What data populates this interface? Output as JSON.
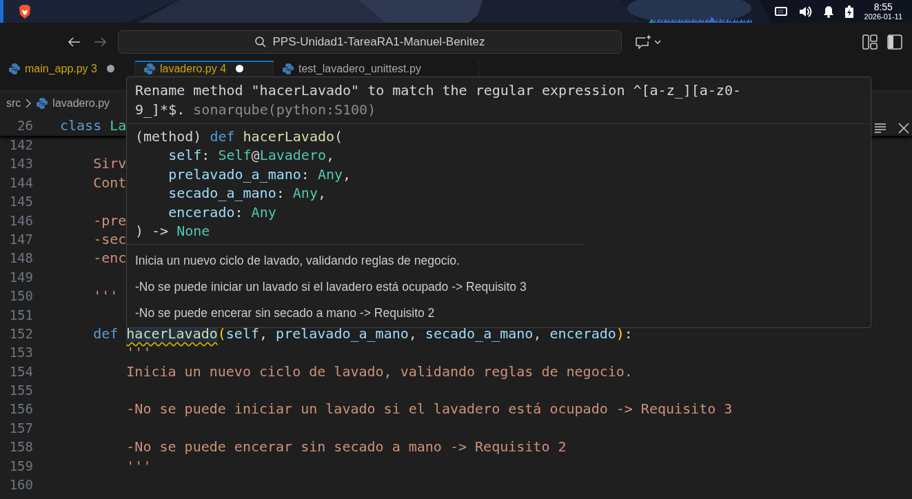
{
  "desktop_panel": {
    "time": "8:55",
    "date": "2026-01-11"
  },
  "title_bar": {
    "search": "PPS-Unidad1-TareaRA1-Manuel-Benitez",
    "forward_disabled": true
  },
  "tabs": [
    {
      "label": "main_app.py",
      "problems": "3",
      "modified": true,
      "selected": false
    },
    {
      "label": "lavadero.py",
      "problems": "4",
      "modified": true,
      "selected": true
    },
    {
      "label": "test_lavadero_unittest.py",
      "modified": false,
      "selected": false
    }
  ],
  "breadcrumb": [
    "src",
    "lavadero.py"
  ],
  "sticky_line": {
    "number": "26",
    "tokens": [
      {
        "text": "class ",
        "kind": "keyword"
      },
      {
        "text": "La",
        "kind": "type"
      }
    ]
  },
  "editor_lines": [
    {
      "number": "142"
    },
    {
      "number": "143",
      "tokens": [
        {
          "text": "    Sirv",
          "kind": "string"
        }
      ]
    },
    {
      "number": "144",
      "tokens": [
        {
          "text": "    Cont",
          "kind": "string"
        }
      ]
    },
    {
      "number": "145"
    },
    {
      "number": "146",
      "tokens": [
        {
          "text": "    -pre",
          "kind": "string"
        }
      ]
    },
    {
      "number": "147",
      "tokens": [
        {
          "text": "    -sec",
          "kind": "string"
        }
      ]
    },
    {
      "number": "148",
      "tokens": [
        {
          "text": "    -enc",
          "kind": "string"
        }
      ]
    },
    {
      "number": "149"
    },
    {
      "number": "150",
      "tokens": [
        {
          "text": "    '''",
          "kind": "string"
        }
      ]
    },
    {
      "number": "151"
    },
    {
      "number": "152",
      "tokens": [
        {
          "text": "    def ",
          "kind": "keyword"
        },
        {
          "text": "hacerLavado",
          "kind": "function",
          "warning": true
        },
        {
          "text": "(",
          "kind": "bracket"
        },
        {
          "text": "self",
          "kind": "param"
        },
        {
          "text": ", ",
          "kind": "plain"
        },
        {
          "text": "prelavado_a_mano",
          "kind": "param"
        },
        {
          "text": ", ",
          "kind": "plain"
        },
        {
          "text": "secado_a_mano",
          "kind": "param"
        },
        {
          "text": ", ",
          "kind": "plain"
        },
        {
          "text": "encerado",
          "kind": "param"
        },
        {
          "text": ")",
          "kind": "bracket"
        },
        {
          "text": ":",
          "kind": "plain"
        }
      ]
    },
    {
      "number": "153",
      "tokens": [
        {
          "text": "        '''",
          "kind": "string"
        }
      ]
    },
    {
      "number": "154",
      "tokens": [
        {
          "text": "        Inicia un nuevo ciclo de lavado, validando reglas de negocio.",
          "kind": "string"
        }
      ]
    },
    {
      "number": "155"
    },
    {
      "number": "156",
      "tokens": [
        {
          "text": "        -No se puede iniciar un lavado si el lavadero está ocupado -> Requisito 3",
          "kind": "string"
        }
      ]
    },
    {
      "number": "157"
    },
    {
      "number": "158",
      "tokens": [
        {
          "text": "        -No se puede encerar sin secado a mano -> Requisito 2",
          "kind": "string"
        }
      ]
    },
    {
      "number": "159",
      "tokens": [
        {
          "text": "        '''",
          "kind": "string"
        }
      ]
    },
    {
      "number": "160"
    }
  ],
  "hover": {
    "message": "Rename method \"hacerLavado\" to match the regular expression ^[a-z_][a-z0-9_]*$.",
    "source": "sonarqube(python:S100)",
    "signature": [
      [
        {
          "text": "(method) ",
          "kind": "plain"
        },
        {
          "text": "def ",
          "kind": "keyword"
        },
        {
          "text": "hacerLavado",
          "kind": "function"
        },
        {
          "text": "(",
          "kind": "plain"
        }
      ],
      [
        {
          "text": "    self",
          "kind": "param"
        },
        {
          "text": ": ",
          "kind": "plain"
        },
        {
          "text": "Self",
          "kind": "type"
        },
        {
          "text": "@",
          "kind": "plain"
        },
        {
          "text": "Lavadero",
          "kind": "type"
        },
        {
          "text": ",",
          "kind": "plain"
        }
      ],
      [
        {
          "text": "    prelavado_a_mano",
          "kind": "param"
        },
        {
          "text": ": ",
          "kind": "plain"
        },
        {
          "text": "Any",
          "kind": "type"
        },
        {
          "text": ",",
          "kind": "plain"
        }
      ],
      [
        {
          "text": "    secado_a_mano",
          "kind": "param"
        },
        {
          "text": ": ",
          "kind": "plain"
        },
        {
          "text": "Any",
          "kind": "type"
        },
        {
          "text": ",",
          "kind": "plain"
        }
      ],
      [
        {
          "text": "    encerado",
          "kind": "param"
        },
        {
          "text": ": ",
          "kind": "plain"
        },
        {
          "text": "Any",
          "kind": "type"
        }
      ],
      [
        {
          "text": ") -> ",
          "kind": "plain"
        },
        {
          "text": "None",
          "kind": "type"
        }
      ]
    ],
    "paragraphs": [
      "Inicia un nuevo ciclo de lavado, validando reglas de negocio.",
      "-No se puede iniciar un lavado si el lavadero está ocupado -> Requisito 3",
      "-No se puede encerar sin secado a mano -> Requisito 2"
    ]
  }
}
